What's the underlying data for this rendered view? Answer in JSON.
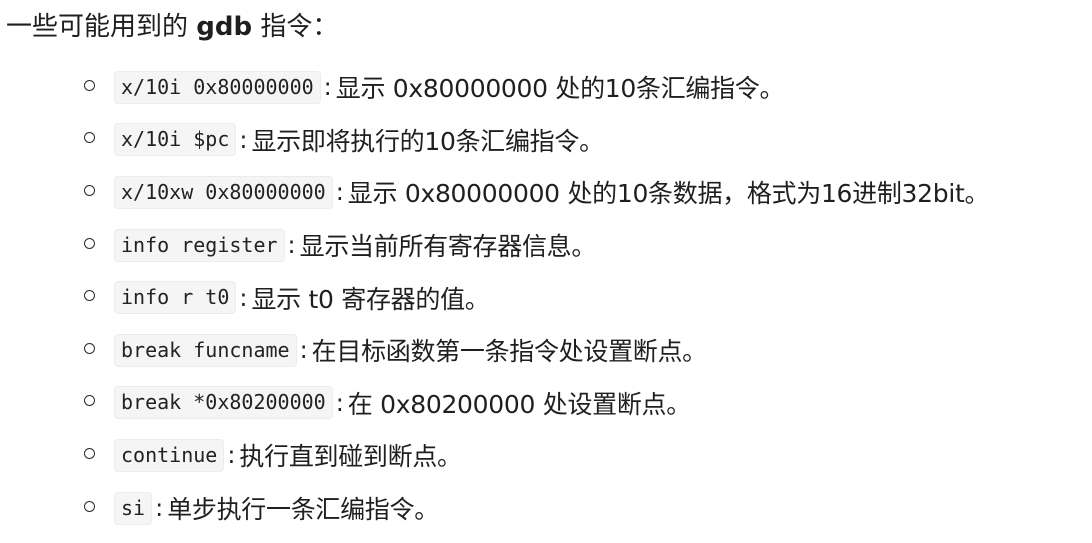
{
  "intro": {
    "prefix": "一些可能用到的 ",
    "keyword": "gdb",
    "suffix": " 指令："
  },
  "commands": [
    {
      "code": "x/10i 0x80000000",
      "desc": "显示 0x80000000 处的10条汇编指令。"
    },
    {
      "code": "x/10i $pc",
      "desc": "显示即将执行的10条汇编指令。"
    },
    {
      "code": "x/10xw 0x80000000",
      "desc": "显示 0x80000000 处的10条数据，格式为16进制32bit。"
    },
    {
      "code": "info register",
      "desc": "显示当前所有寄存器信息。"
    },
    {
      "code": "info r t0",
      "desc": "显示 t0 寄存器的值。"
    },
    {
      "code": "break funcname",
      "desc": "在目标函数第一条指令处设置断点。"
    },
    {
      "code": "break *0x80200000",
      "desc": "在 0x80200000 处设置断点。"
    },
    {
      "code": "continue",
      "desc": "执行直到碰到断点。"
    },
    {
      "code": "si",
      "desc": "单步执行一条汇编指令。"
    }
  ],
  "separator": ":"
}
